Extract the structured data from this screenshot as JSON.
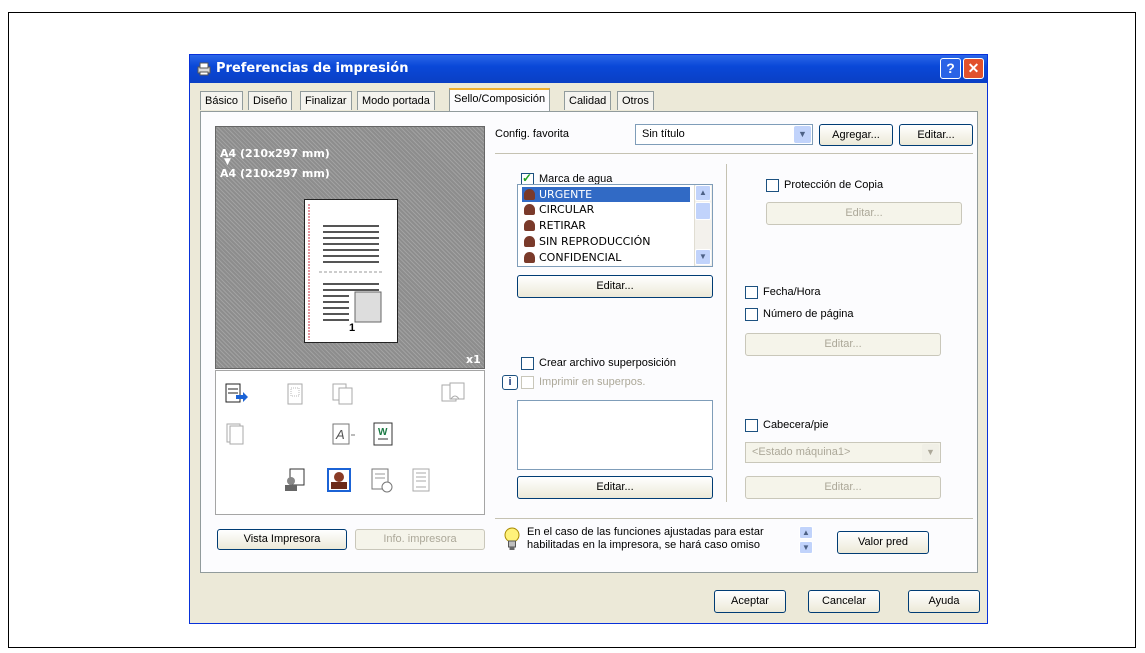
{
  "window": {
    "title": "Preferencias de impresión",
    "help_glyph": "?",
    "close_glyph": "✕"
  },
  "tabs": [
    {
      "label": "Básico"
    },
    {
      "label": "Diseño"
    },
    {
      "label": "Finalizar"
    },
    {
      "label": "Modo portada"
    },
    {
      "label": "Sello/Composición",
      "active": true
    },
    {
      "label": "Calidad"
    },
    {
      "label": "Otros"
    }
  ],
  "preview": {
    "paper_in": "A4 (210x297 mm)",
    "arrow": "▼",
    "paper_out": "A4 (210x297 mm)",
    "copies": "x1",
    "page_number": "1"
  },
  "left_buttons": {
    "vista_impresora": "Vista Impresora",
    "info_impresora": "Info. impresora"
  },
  "config": {
    "label": "Config. favorita",
    "value": "Sin título",
    "add_label": "Agregar...",
    "edit_label": "Editar..."
  },
  "watermark": {
    "checkbox_label": "Marca de agua",
    "checked": true,
    "items": [
      "URGENTE",
      "CIRCULAR",
      "RETIRAR",
      "SIN REPRODUCCIÓN",
      "CONFIDENCIAL"
    ],
    "selected": "URGENTE",
    "edit_label": "Editar..."
  },
  "overlay": {
    "create_label": "Crear archivo superposición",
    "print_label": "Imprimir en superpos.",
    "info_glyph": "i",
    "edit_label": "Editar..."
  },
  "copy_protection": {
    "label": "Protección de Copia",
    "edit_label": "Editar..."
  },
  "date_time": {
    "label": "Fecha/Hora"
  },
  "page_number": {
    "label": "Número de página",
    "edit_label": "Editar..."
  },
  "header_footer": {
    "label": "Cabecera/pie",
    "select_value": "<Estado máquina1>",
    "edit_label": "Editar..."
  },
  "hint": {
    "line1": "En el caso de las funciones ajustadas para estar",
    "line2": "habilitadas en la impresora, se hará caso omiso"
  },
  "default_button": "Valor pred",
  "footer": {
    "ok": "Aceptar",
    "cancel": "Cancelar",
    "help": "Ayuda"
  },
  "colors": {
    "titlebar": "#0a48d8",
    "dialog_bg": "#ece9d8",
    "selection": "#316ac5",
    "close_button": "#e2512c"
  }
}
